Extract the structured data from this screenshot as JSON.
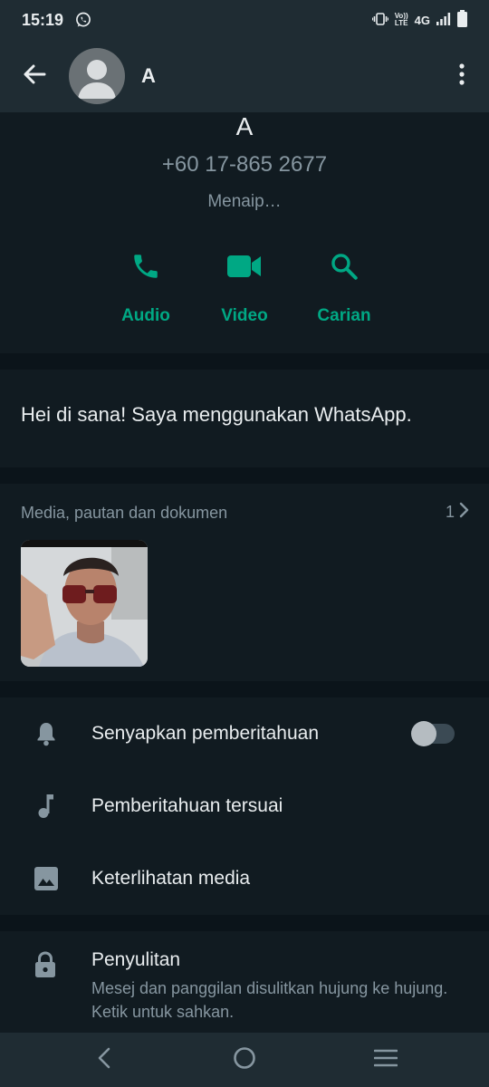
{
  "status_bar": {
    "time": "15:19",
    "network": "4G",
    "icons": [
      "whatsapp-icon",
      "vibrate-icon",
      "volte-icon",
      "signal-icon",
      "battery-icon"
    ],
    "volte_top": "Vo))",
    "volte_bottom": "LTE"
  },
  "app_bar": {
    "title": "A",
    "icons": [
      "back-arrow-icon",
      "default-avatar-icon",
      "more-vert-icon"
    ]
  },
  "contact": {
    "name": "A",
    "phone": "+60 17-865 2677",
    "status": "Menaip…"
  },
  "actions": [
    {
      "label": "Audio",
      "icon": "phone-icon"
    },
    {
      "label": "Video",
      "icon": "videocam-icon"
    },
    {
      "label": "Carian",
      "icon": "search-icon"
    }
  ],
  "about": {
    "text": "Hei di sana! Saya menggunakan WhatsApp."
  },
  "media": {
    "header": "Media, pautan dan dokumen",
    "count": "1",
    "thumbnail_desc": "photo"
  },
  "settings": [
    {
      "label": "Senyapkan pemberitahuan",
      "icon": "bell-icon",
      "toggle_on": false
    },
    {
      "label": "Pemberitahuan tersuai",
      "icon": "music-note-icon"
    },
    {
      "label": "Keterlihatan media",
      "icon": "image-icon"
    }
  ],
  "encryption": {
    "title": "Penyulitan",
    "description": "Mesej dan panggilan disulitkan hujung ke hujung. Ketik untuk sahkan.",
    "icon": "lock-icon"
  },
  "nav_bar": {
    "icons": [
      "nav-back-icon",
      "nav-home-icon",
      "nav-recents-icon"
    ]
  },
  "colors": {
    "accent": "#00a884",
    "background": "#0b141a",
    "surface": "#111b21",
    "bar": "#1f2c33",
    "primary_text": "#e9edef",
    "secondary_text": "#8696a0"
  }
}
